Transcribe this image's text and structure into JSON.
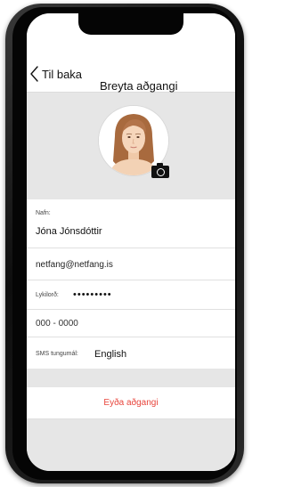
{
  "header": {
    "back_label": "Til baka",
    "title": "Breyta aðgangi"
  },
  "profile": {
    "avatar_icon": "user-portrait",
    "camera_icon": "camera-icon"
  },
  "form": {
    "name_label": "Nafn:",
    "name_value": "Jóna Jónsdóttir",
    "email_value": "netfang@netfang.is",
    "password_label": "Lykilorð:",
    "password_value": "•••••••••",
    "phone_value": "000 - 0000",
    "sms_label": "SMS tungumál:",
    "sms_value": "English"
  },
  "actions": {
    "delete_label": "Eyða aðgangi"
  },
  "colors": {
    "accent_danger": "#e8453c",
    "background": "#e6e6e6"
  }
}
